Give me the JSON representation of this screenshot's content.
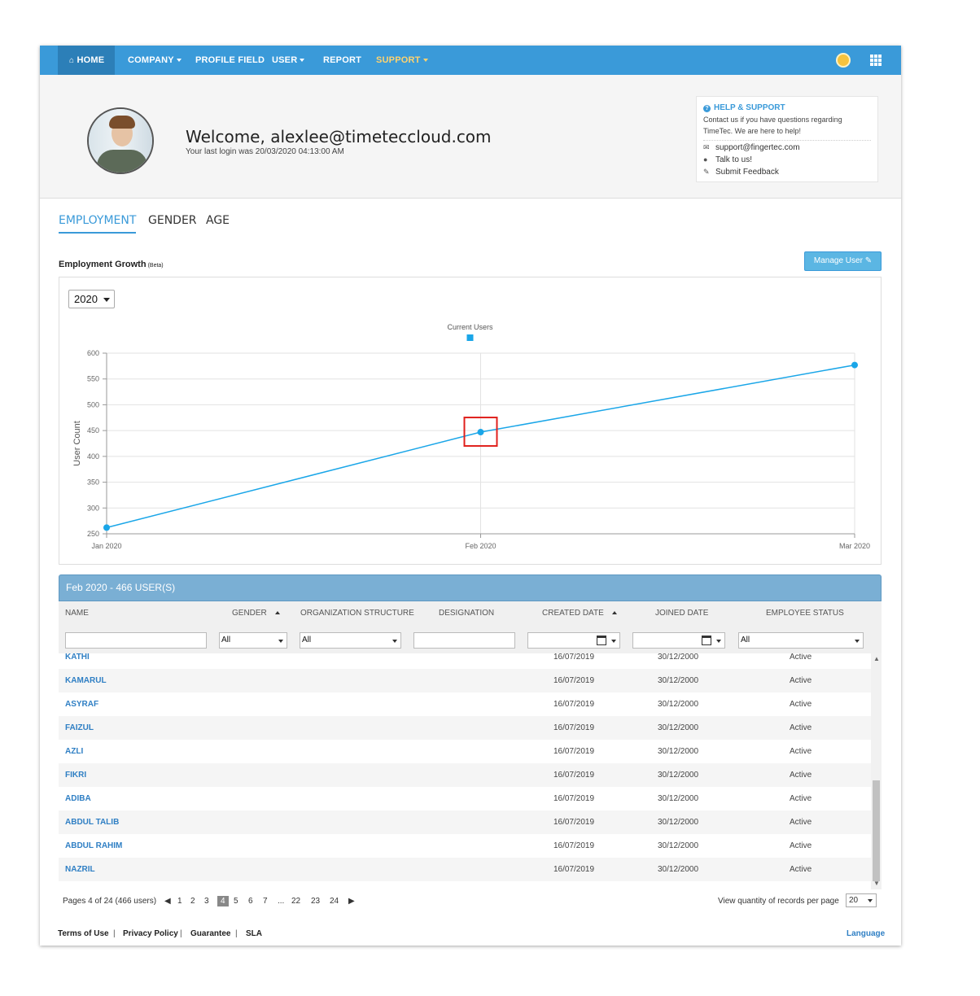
{
  "nav": {
    "items": [
      {
        "label": "HOME",
        "icon": "home-icon"
      },
      {
        "label": "COMPANY",
        "dropdown": true
      },
      {
        "label": "PROFILE FIELD"
      },
      {
        "label": "USER",
        "dropdown": true
      },
      {
        "label": "REPORT"
      },
      {
        "label": "SUPPORT",
        "dropdown": true
      }
    ],
    "right_icons": [
      "lightbulb-icon",
      "app-grid-icon"
    ],
    "colors": {
      "bar": "#3a9ad9",
      "active": "#2c7fb8",
      "support": "#ffd36e"
    }
  },
  "header": {
    "welcome": "Welcome, alexlee@timeteccloud.com",
    "last_login": "Your last login was 20/03/2020 04:13:00 AM",
    "help": {
      "title": "HELP & SUPPORT",
      "text": "Contact us if you have questions regarding TimeTec. We are here to help!",
      "email": "support@fingertec.com",
      "talk": "Talk to us!",
      "feedback": "Submit Feedback"
    }
  },
  "tabs": [
    "EMPLOYMENT",
    "GENDER",
    "AGE"
  ],
  "growth": {
    "title": "Employment Growth",
    "beta": "(Beta)",
    "manage_button": "Manage User",
    "year": "2020"
  },
  "chart_data": {
    "type": "line",
    "legend": "Current Users",
    "legend_position": "top-center",
    "categories": [
      "Jan 2020",
      "Feb 2020",
      "Mar 2020"
    ],
    "series": [
      {
        "name": "Current Users",
        "values": [
          262,
          447,
          577
        ],
        "color": "#1aa6e8"
      }
    ],
    "ylabel": "User Count",
    "ylim": [
      250,
      600
    ],
    "yticks": [
      250,
      300,
      350,
      400,
      450,
      500,
      550,
      600
    ],
    "grid": true,
    "highlighted_point": "Feb 2020"
  },
  "table": {
    "title": "Feb 2020 - 466 USER(S)",
    "columns": [
      "NAME",
      "GENDER",
      "ORGANIZATION STRUCTURE",
      "DESIGNATION",
      "CREATED DATE",
      "JOINED DATE",
      "EMPLOYEE STATUS"
    ],
    "filters": {
      "gender": "All",
      "org": "All",
      "status": "All"
    },
    "rows": [
      {
        "name": "KATHI",
        "created": "16/07/2019",
        "joined": "30/12/2000",
        "status": "Active"
      },
      {
        "name": "KAMARUL",
        "created": "16/07/2019",
        "joined": "30/12/2000",
        "status": "Active"
      },
      {
        "name": "ASYRAF",
        "created": "16/07/2019",
        "joined": "30/12/2000",
        "status": "Active"
      },
      {
        "name": "FAIZUL",
        "created": "16/07/2019",
        "joined": "30/12/2000",
        "status": "Active"
      },
      {
        "name": "AZLI",
        "created": "16/07/2019",
        "joined": "30/12/2000",
        "status": "Active"
      },
      {
        "name": "FIKRI",
        "created": "16/07/2019",
        "joined": "30/12/2000",
        "status": "Active"
      },
      {
        "name": "ADIBA",
        "created": "16/07/2019",
        "joined": "30/12/2000",
        "status": "Active"
      },
      {
        "name": "ABDUL TALIB",
        "created": "16/07/2019",
        "joined": "30/12/2000",
        "status": "Active"
      },
      {
        "name": "ABDUL RAHIM",
        "created": "16/07/2019",
        "joined": "30/12/2000",
        "status": "Active"
      },
      {
        "name": "NAZRIL",
        "created": "16/07/2019",
        "joined": "30/12/2000",
        "status": "Active"
      }
    ]
  },
  "pagination": {
    "summary": "Pages 4 of 24 (466 users)",
    "pages": [
      "1",
      "2",
      "3",
      "4",
      "5",
      "6",
      "7",
      "...",
      "22",
      "23",
      "24"
    ],
    "current": "4",
    "per_page_label": "View quantity of records per page",
    "per_page": "20"
  },
  "footer": {
    "links": [
      "Terms of Use",
      "Privacy Policy",
      "Guarantee",
      "SLA"
    ],
    "language": "Language"
  }
}
